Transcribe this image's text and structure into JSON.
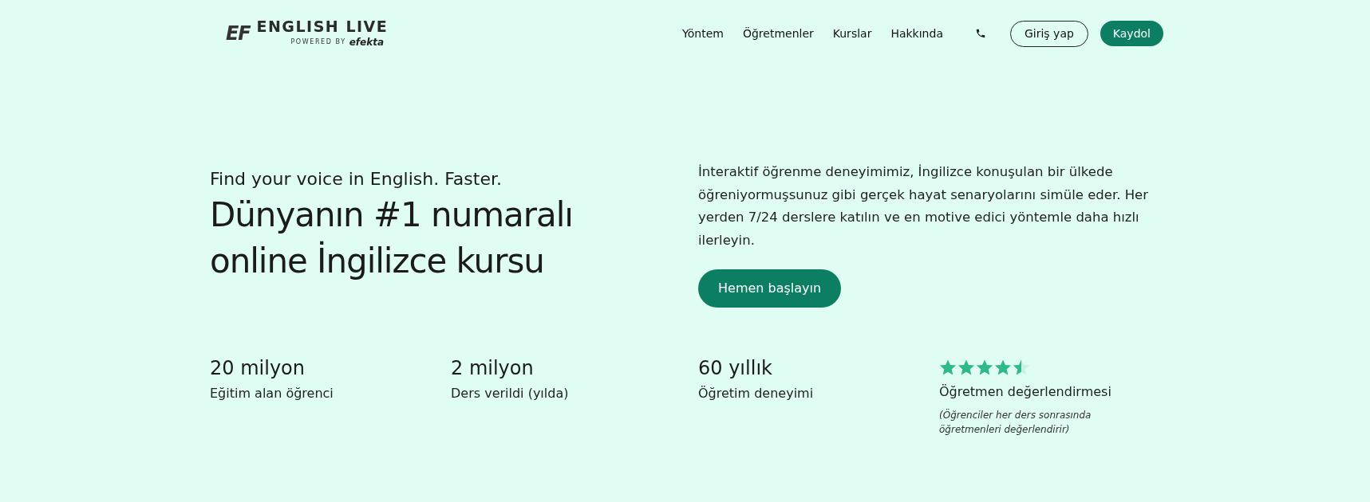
{
  "header": {
    "logo": {
      "mark": "EF",
      "name": "ENGLISH LIVE",
      "powered_by": "POWERED BY",
      "brand": "efekta"
    },
    "nav": [
      {
        "label": "Yöntem"
      },
      {
        "label": "Öğretmenler"
      },
      {
        "label": "Kurslar"
      },
      {
        "label": "Hakkında"
      }
    ],
    "login": "Giriş yap",
    "signup": "Kaydol"
  },
  "hero": {
    "tagline": "Find your voice in English. Faster.",
    "headline": [
      "Dünyanın #1 numaralı",
      "online İngilizce kursu"
    ],
    "description": "İnteraktif öğrenme deneyimimiz, İngilizce konuşulan bir ülkede öğreniyormuşsunuz gibi gerçek hayat senaryolarını simüle eder. Her yerden 7/24 derslere katılın ve en motive edici yöntemle daha hızlı ilerleyin.",
    "cta": "Hemen başlayın"
  },
  "stats": [
    {
      "kind": "figure",
      "value": "20 milyon",
      "label": "Eğitim alan öğrenci"
    },
    {
      "kind": "figure",
      "value": "2 milyon",
      "label": "Ders verildi (yılda)"
    },
    {
      "kind": "figure",
      "value": "60 yıllık",
      "label": "Öğretim deneyimi"
    },
    {
      "kind": "rating",
      "stars": 4.5,
      "label": "Öğretmen değerlendirmesi",
      "note": "(Öğrenciler her ders sonrasında öğretmenleri değerlendirir)"
    }
  ]
}
